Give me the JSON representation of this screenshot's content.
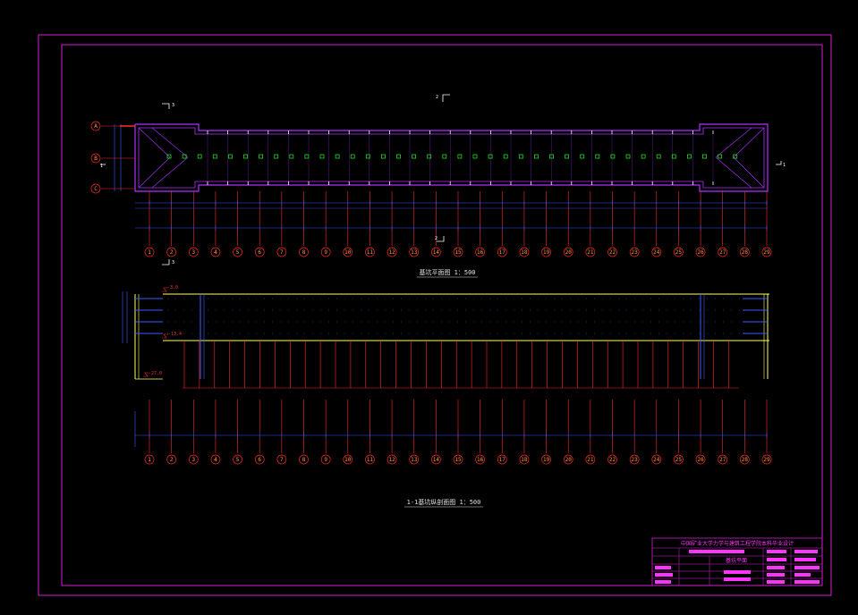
{
  "drawing": {
    "colors": {
      "frame": "#d41ed4",
      "wall": "#b030ff",
      "axis_line": "#ff2a2a",
      "axis_bubble": "#ff9933",
      "dimension": "#3a5bff",
      "column": "#22dd22",
      "section_wall": "#ffff66",
      "text": "#e0e0e0",
      "title_block": "#ff33ff"
    },
    "plan": {
      "title": "基坑平面图 1：500",
      "row_axes": [
        "A",
        "B",
        "C"
      ],
      "section_marks": [
        "1",
        "1",
        "2",
        "2",
        "3",
        "3"
      ]
    },
    "section": {
      "title": "1-1基坑纵剖面图 1：500",
      "levels": [
        "-3.0",
        "-13.4",
        "-27.0"
      ]
    },
    "column_axes": [
      "1",
      "2",
      "3",
      "4",
      "5",
      "6",
      "7",
      "8",
      "9",
      "10",
      "11",
      "12",
      "13",
      "14",
      "15",
      "16",
      "17",
      "18",
      "19",
      "20",
      "21",
      "22",
      "23",
      "24",
      "25",
      "26",
      "27",
      "28",
      "29"
    ],
    "title_block": {
      "header": "中国矿业大学力学与建筑工程学院本科毕业设计",
      "drawing_name": "基坑平面"
    }
  }
}
